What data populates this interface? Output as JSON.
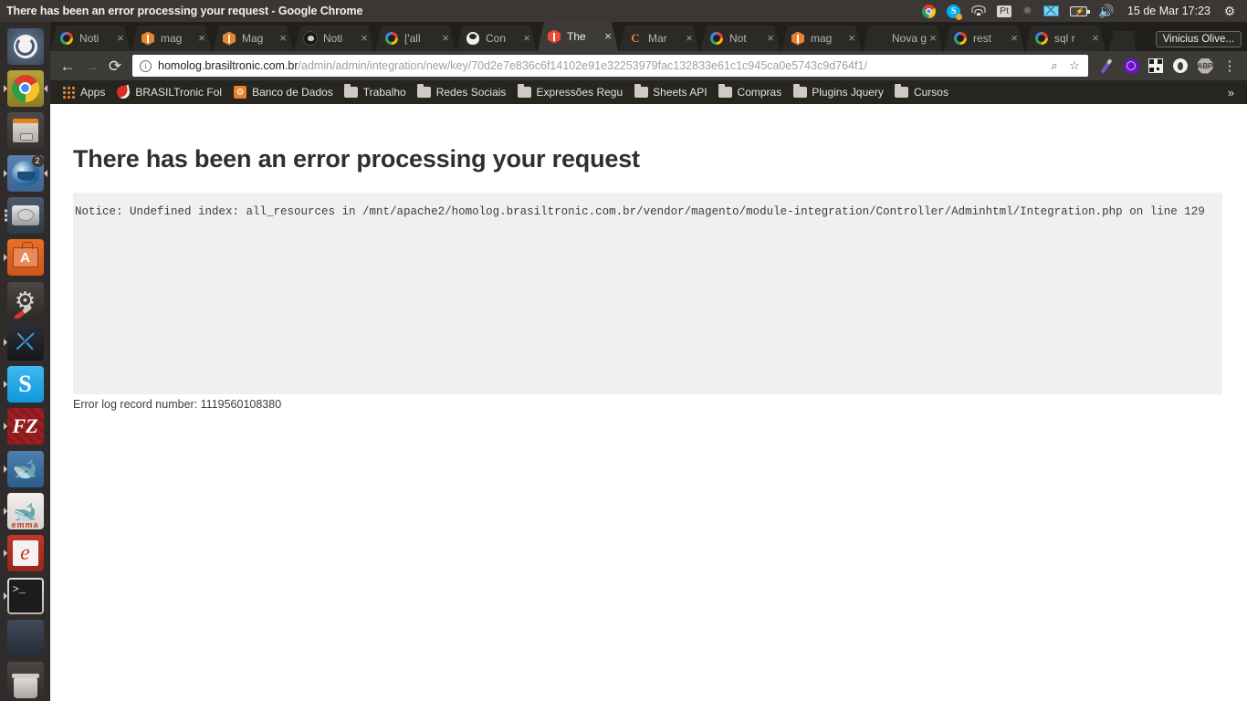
{
  "os_panel": {
    "window_title": "There has been an error processing your request - Google Chrome",
    "tray": {
      "chrome_icon": "chrome-icon",
      "skype_icon": "skype-icon",
      "wifi_icon": "wifi-icon",
      "keyboard_layout": "Pt",
      "bluetooth_icon": "bluetooth-icon",
      "mail_icon": "mail-icon",
      "battery_icon": "battery-icon",
      "volume_icon": "volume-icon",
      "clock": "15 de Mar 17:23",
      "session_icon": "gear-icon"
    }
  },
  "launcher": {
    "items": [
      {
        "name": "ubuntu-dash",
        "icon": "ubuntu-icon",
        "badge": ""
      },
      {
        "name": "google-chrome",
        "icon": "chrome-icon",
        "badge": ""
      },
      {
        "name": "files",
        "icon": "files-icon",
        "badge": ""
      },
      {
        "name": "thunderbird",
        "icon": "thunderbird-icon",
        "badge": "2"
      },
      {
        "name": "disks",
        "icon": "disk-icon",
        "badge": ""
      },
      {
        "name": "ubuntu-software",
        "icon": "software-bag-icon",
        "badge": ""
      },
      {
        "name": "system-settings",
        "icon": "gear-wrench-icon",
        "badge": ""
      },
      {
        "name": "visual-studio-code",
        "icon": "vscode-icon",
        "badge": ""
      },
      {
        "name": "skype",
        "icon": "skype-icon",
        "badge": ""
      },
      {
        "name": "filezilla",
        "icon": "filezilla-icon",
        "badge": ""
      },
      {
        "name": "mysql-workbench",
        "icon": "dolphin-wrench-icon",
        "badge": ""
      },
      {
        "name": "emma",
        "icon": "emma-dolphin-icon",
        "badge": "",
        "label": "emma"
      },
      {
        "name": "evolution",
        "icon": "evolution-icon",
        "badge": ""
      },
      {
        "name": "terminal",
        "icon": "terminal-icon",
        "badge": "",
        "prompt": ">_"
      },
      {
        "name": "disk-utility",
        "icon": "disk-icon",
        "badge": ""
      },
      {
        "name": "trash",
        "icon": "trash-icon",
        "badge": ""
      }
    ]
  },
  "browser": {
    "tabs": [
      {
        "label": "Noti",
        "favicon": "google-icon",
        "active": false
      },
      {
        "label": "mag",
        "favicon": "magento-icon",
        "active": false
      },
      {
        "label": "Mag",
        "favicon": "magento-icon",
        "active": false
      },
      {
        "label": "Noti",
        "favicon": "github-icon",
        "active": false
      },
      {
        "label": "['all",
        "favicon": "google-icon",
        "active": false
      },
      {
        "label": "Con",
        "favicon": "linux-penguin-icon",
        "active": false
      },
      {
        "label": "The",
        "favicon": "magento-icon",
        "active": true
      },
      {
        "label": "Mar",
        "favicon": "c-letter-icon",
        "active": false
      },
      {
        "label": "Not",
        "favicon": "google-icon",
        "active": false
      },
      {
        "label": "mag",
        "favicon": "magento-icon",
        "active": false
      },
      {
        "label": "Nova g",
        "favicon": "no-icon",
        "active": false
      },
      {
        "label": "rest",
        "favicon": "google-icon",
        "active": false
      },
      {
        "label": "sql r",
        "favicon": "google-icon",
        "active": false
      }
    ],
    "tab_close_glyph": "×",
    "new_tab_button": "new-tab-button",
    "profile_label": "Vinicius Olive...",
    "toolbar": {
      "back_glyph": "←",
      "forward_glyph": "→",
      "reload_glyph": "⟳",
      "info_glyph": "i",
      "url_host": "homolog.brasiltronic.com.br",
      "url_path": "/admin/admin/integration/new/key/70d2e7e836c6f14102e91e32253979fac132833e61c1c945ca0e5743c9d764f1/",
      "search_glyph": "⌕",
      "bookmark_glyph": "☆",
      "extensions": [
        {
          "name": "eyedropper-extension-icon"
        },
        {
          "name": "purple-circle-extension-icon"
        },
        {
          "name": "qr-code-extension-icon"
        },
        {
          "name": "white-circle-extension-icon"
        },
        {
          "name": "adblock-plus-extension-icon",
          "label": "ABP"
        }
      ],
      "menu_glyph": "⋮"
    },
    "bookmarks": [
      {
        "label": "Apps",
        "icon": "apps-grid-icon"
      },
      {
        "label": "BRASILTronic Fol",
        "icon": "brasiltronic-icon"
      },
      {
        "label": "Banco de Dados",
        "icon": "phpmyadmin-icon"
      },
      {
        "label": "Trabalho",
        "icon": "folder-icon"
      },
      {
        "label": "Redes Sociais",
        "icon": "folder-icon"
      },
      {
        "label": "Expressões Regu",
        "icon": "folder-icon"
      },
      {
        "label": "Sheets API",
        "icon": "folder-icon"
      },
      {
        "label": "Compras",
        "icon": "folder-icon"
      },
      {
        "label": "Plugins Jquery",
        "icon": "folder-icon"
      },
      {
        "label": "Cursos",
        "icon": "folder-icon"
      }
    ],
    "bookmarks_overflow_glyph": "»"
  },
  "page": {
    "heading": "There has been an error processing your request",
    "notice": "Notice: Undefined index: all_resources in /mnt/apache2/homolog.brasiltronic.com.br/vendor/magento/module-integration/Controller/Adminhtml/Integration.php on line 129",
    "error_log_line": "Error log record number: 1119560108380"
  },
  "colors": {
    "panel_bg": "#3b3735",
    "launcher_bg": "#2f2c2b",
    "tabstrip_bg": "#201f1c",
    "toolbar_bg": "#3c3b37",
    "bookmarks_bg": "#26251f",
    "page_bg": "#ffffff",
    "error_box_bg": "#f0f0f0",
    "accent_orange": "#e8822c"
  }
}
